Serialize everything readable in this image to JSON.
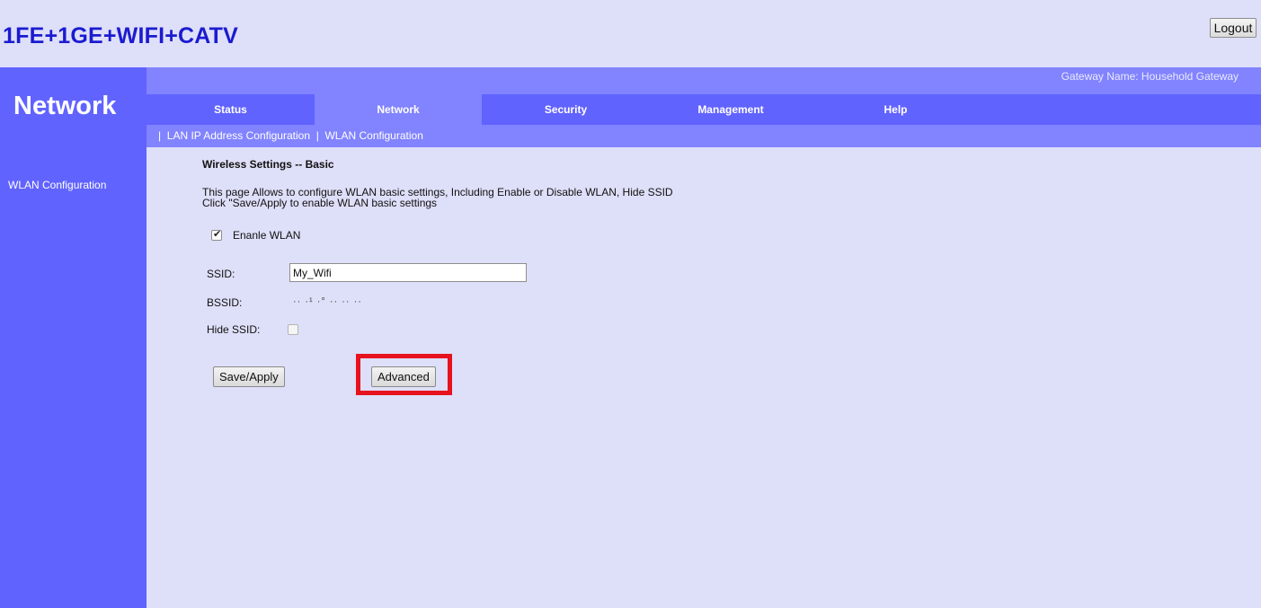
{
  "header": {
    "brand": "1FE+1GE+WIFI+CATV",
    "logout_label": "Logout",
    "gateway_name": "Gateway Name: Household Gateway"
  },
  "sidebar": {
    "title": "Network",
    "items": [
      {
        "label": "WLAN Configuration"
      }
    ]
  },
  "nav": {
    "tabs": [
      {
        "label": "Status",
        "active": false
      },
      {
        "label": "Network",
        "active": true
      },
      {
        "label": "Security",
        "active": false
      },
      {
        "label": "Management",
        "active": false
      },
      {
        "label": "Help",
        "active": false
      }
    ]
  },
  "subnav": {
    "sep": "|",
    "items": [
      {
        "label": "LAN IP Address Configuration"
      },
      {
        "label": "WLAN Configuration"
      }
    ]
  },
  "main": {
    "section_title": "Wireless Settings -- Basic",
    "desc_line1": "This page Allows to configure WLAN basic settings, Including Enable or Disable WLAN, Hide SSID",
    "desc_line2": "Click \"Save/Apply to enable WLAN basic settings",
    "enable_wlan": {
      "label": "Enanle WLAN",
      "checked": true
    },
    "ssid": {
      "label": "SSID:",
      "value": "My_Wifi"
    },
    "bssid": {
      "label": "BSSID:",
      "value": "·· ·¹ ·° ·· ·· ··"
    },
    "hide_ssid": {
      "label": "Hide SSID:",
      "checked": false
    },
    "save_label": "Save/Apply",
    "advanced_label": "Advanced"
  },
  "colors": {
    "background": "#dedff8",
    "sidebar": "#6163ff",
    "bar_light": "#8183ff",
    "brand_text": "#1b1bd0",
    "highlight": "#e6121d"
  }
}
